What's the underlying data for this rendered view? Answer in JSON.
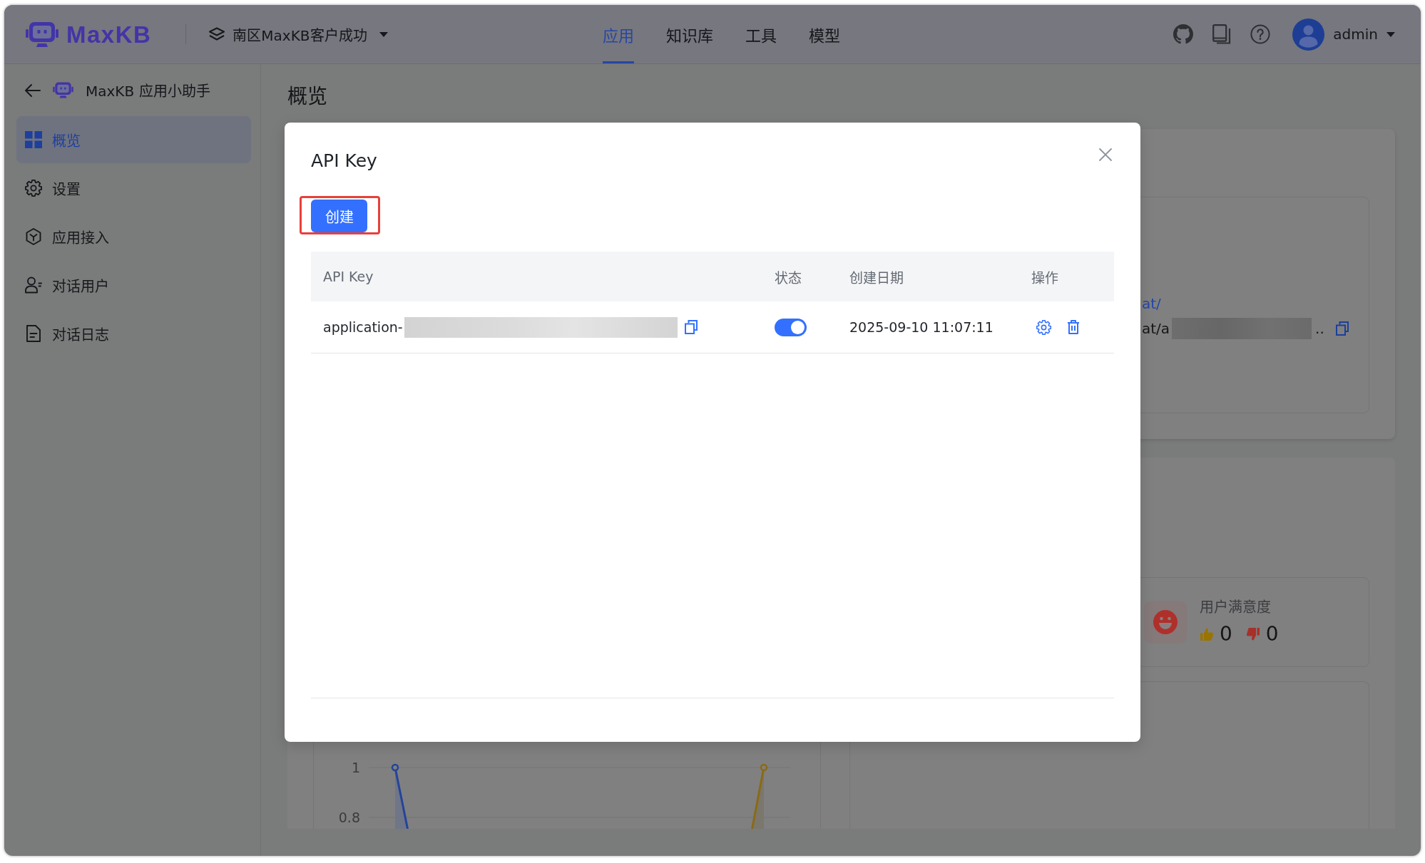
{
  "header": {
    "logo": "MaxKB",
    "workspace": "南区MaxKB客户成功",
    "nav": [
      {
        "label": "应用",
        "selected": true
      },
      {
        "label": "知识库",
        "selected": false
      },
      {
        "label": "工具",
        "selected": false
      },
      {
        "label": "模型",
        "selected": false
      }
    ],
    "user": "admin"
  },
  "sidebar": {
    "app_name": "MaxKB 应用小助手",
    "items": [
      {
        "label": "概览",
        "selected": true
      },
      {
        "label": "设置",
        "selected": false
      },
      {
        "label": "应用接入",
        "selected": false
      },
      {
        "label": "对话用户",
        "selected": false
      },
      {
        "label": "对话日志",
        "selected": false
      }
    ]
  },
  "overview": {
    "title": "概览",
    "access": {
      "link": "at/",
      "url_start": "at/a",
      "url_end": ".."
    },
    "satisfaction": {
      "label": "用户满意度",
      "likes": "0",
      "dislikes": "0"
    },
    "trend_chart": {
      "y_labels": [
        "1",
        "0.8"
      ]
    }
  },
  "dialog": {
    "title": "API Key",
    "create_button": {
      "label": "创建",
      "highlighted": true
    },
    "table": {
      "columns": [
        "API Key",
        "状态",
        "创建日期",
        "操作"
      ],
      "rows": [
        {
          "api_key": "application-",
          "enabled": true,
          "created": "2025-09-10 11:07:11"
        }
      ]
    }
  }
}
